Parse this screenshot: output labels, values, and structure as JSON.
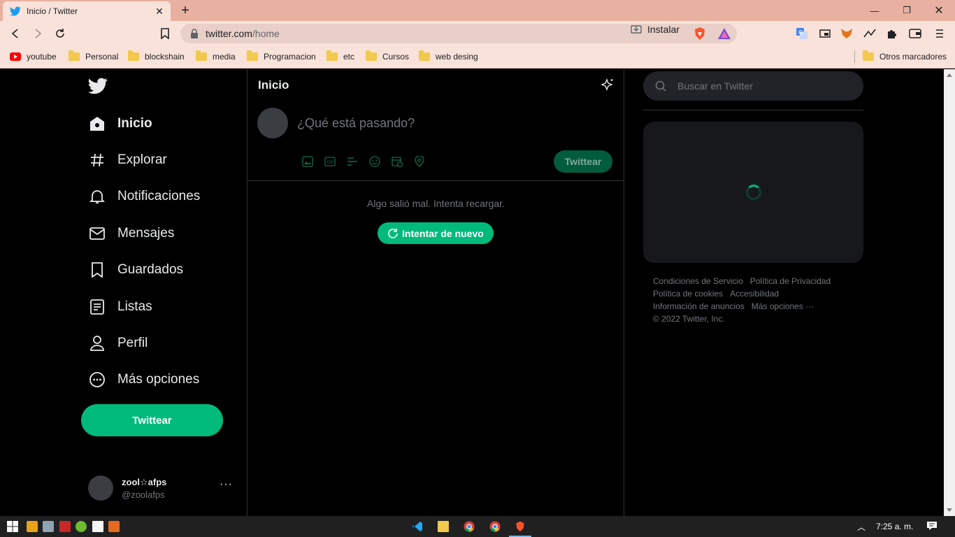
{
  "browser": {
    "tab_title": "Inicio / Twitter",
    "url_host": "twitter.com",
    "url_path": "/home",
    "install_label": "Instalar",
    "bookmarks": [
      "youtube",
      "Personal",
      "blockshain",
      "media",
      "Programacion",
      "etc",
      "Cursos",
      "web desing"
    ],
    "other_bookmarks": "Otros marcadores"
  },
  "sidebar": {
    "items": [
      {
        "label": "Inicio",
        "icon": "home-icon"
      },
      {
        "label": "Explorar",
        "icon": "hashtag-icon"
      },
      {
        "label": "Notificaciones",
        "icon": "bell-icon"
      },
      {
        "label": "Mensajes",
        "icon": "envelope-icon"
      },
      {
        "label": "Guardados",
        "icon": "bookmark-icon"
      },
      {
        "label": "Listas",
        "icon": "list-icon"
      },
      {
        "label": "Perfil",
        "icon": "person-icon"
      },
      {
        "label": "Más opciones",
        "icon": "more-circle-icon"
      }
    ],
    "tweet_button": "Twittear",
    "account": {
      "name": "zool☆afps",
      "handle": "@zoolafps",
      "more": "···"
    }
  },
  "main": {
    "title": "Inicio",
    "compose_placeholder": "¿Qué está pasando?",
    "tweet_button": "Twittear",
    "error_message": "Algo salió mal. Intenta recargar.",
    "retry_button": "Intentar de nuevo"
  },
  "right": {
    "search_placeholder": "Buscar en Twitter",
    "footer": {
      "terms": "Condiciones de Servicio",
      "privacy": "Política de Privacidad",
      "cookies": "Política de cookies",
      "accessibility": "Accesibilidad",
      "ads_info": "Información de anuncios",
      "more": "Más opciones ···",
      "copyright": "© 2022 Twitter, Inc."
    }
  },
  "taskbar": {
    "clock": "7:25 a. m."
  },
  "colors": {
    "accent": "#00ba7c",
    "background": "#000000",
    "chrome_tab": "#e8b0a0"
  }
}
